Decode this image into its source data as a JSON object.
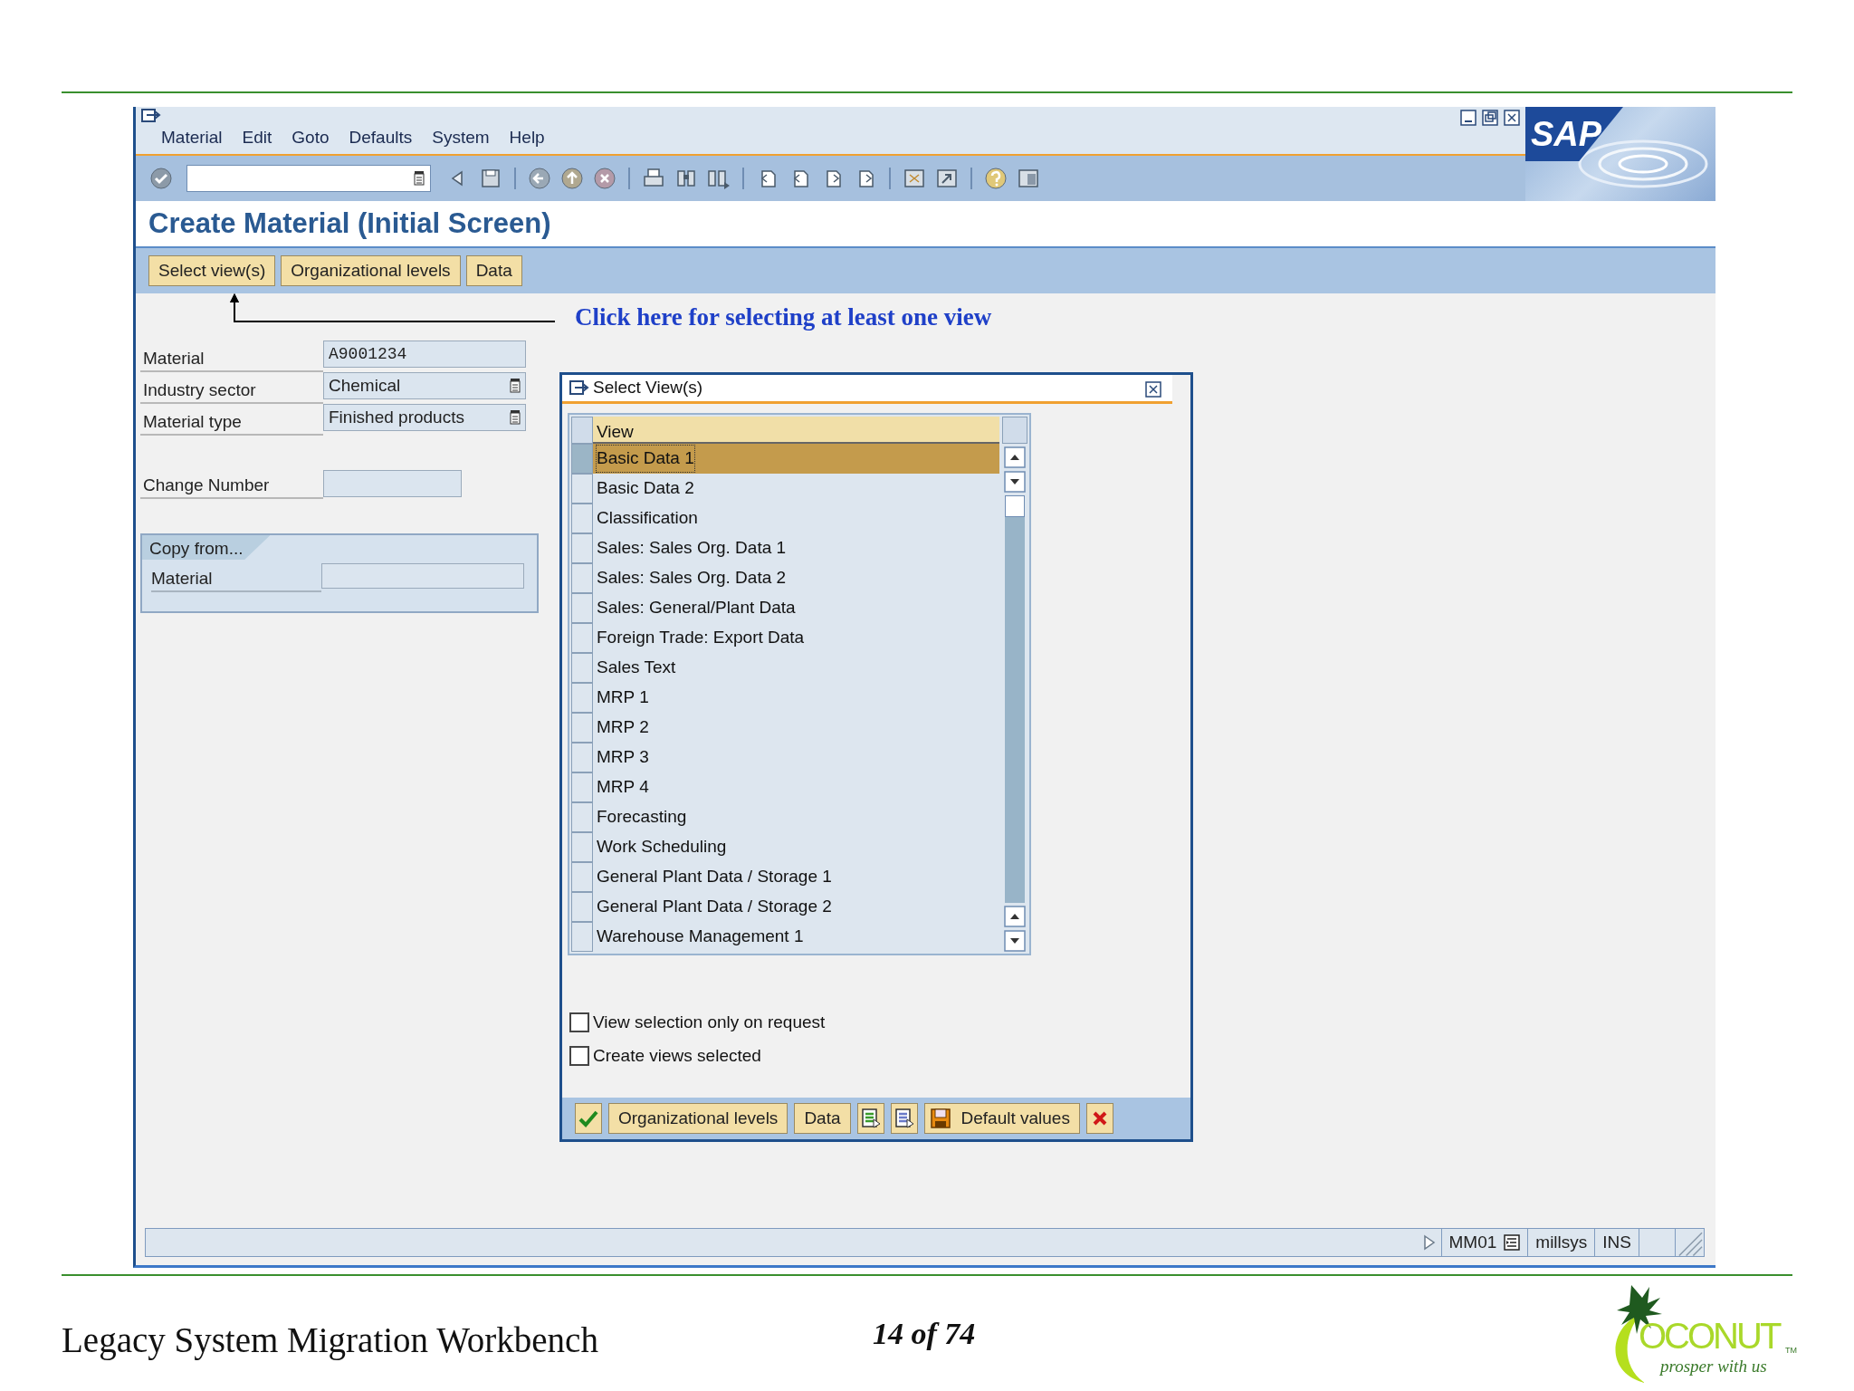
{
  "window": {
    "menu": [
      "Material",
      "Edit",
      "Goto",
      "Defaults",
      "System",
      "Help"
    ],
    "brand": "SAP",
    "title": "Create Material (Initial Screen)",
    "app_toolbar": [
      "Select view(s)",
      "Organizational levels",
      "Data"
    ]
  },
  "annotation": "Click here for selecting at least one view",
  "form": {
    "fields": [
      {
        "label": "Material",
        "value": "A9001234",
        "kind": "text"
      },
      {
        "label": "Industry sector",
        "value": "Chemical",
        "kind": "dropdown"
      },
      {
        "label": "Material type",
        "value": "Finished products",
        "kind": "dropdown"
      }
    ],
    "change_number": {
      "label": "Change Number"
    },
    "copy_from": {
      "title": "Copy from...",
      "fields": [
        {
          "label": "Material"
        }
      ]
    }
  },
  "dialog": {
    "title": "Select View(s)",
    "column": "View",
    "views": [
      {
        "label": "Basic Data 1",
        "selected": true
      },
      {
        "label": "Basic Data 2",
        "selected": false
      },
      {
        "label": "Classification",
        "selected": false
      },
      {
        "label": "Sales: Sales Org. Data 1",
        "selected": false
      },
      {
        "label": "Sales: Sales Org. Data 2",
        "selected": false
      },
      {
        "label": "Sales: General/Plant Data",
        "selected": false
      },
      {
        "label": "Foreign Trade: Export Data",
        "selected": false
      },
      {
        "label": "Sales Text",
        "selected": false
      },
      {
        "label": "MRP 1",
        "selected": false
      },
      {
        "label": "MRP 2",
        "selected": false
      },
      {
        "label": "MRP 3",
        "selected": false
      },
      {
        "label": "MRP 4",
        "selected": false
      },
      {
        "label": "Forecasting",
        "selected": false
      },
      {
        "label": "Work Scheduling",
        "selected": false
      },
      {
        "label": "General Plant Data / Storage 1",
        "selected": false
      },
      {
        "label": "General Plant Data / Storage 2",
        "selected": false
      },
      {
        "label": "Warehouse Management 1",
        "selected": false
      }
    ],
    "options": [
      {
        "label": "View selection only on request",
        "checked": false
      },
      {
        "label": "Create views selected",
        "checked": false
      }
    ],
    "buttons": [
      {
        "kind": "confirm"
      },
      {
        "kind": "text",
        "label": "Organizational levels"
      },
      {
        "kind": "text",
        "label": "Data"
      },
      {
        "kind": "green-list"
      },
      {
        "kind": "blue-list"
      },
      {
        "kind": "save",
        "label": "Default values"
      },
      {
        "kind": "cancel"
      }
    ]
  },
  "status_bar": {
    "transaction": "MM01",
    "system": "millsys",
    "mode": "INS"
  },
  "slide": {
    "footer_title": "Legacy System Migration Workbench",
    "page_number": "14 of 74",
    "logo": {
      "wordmark": "OCONUT",
      "trademark": "TM",
      "tagline": "prosper with us"
    }
  }
}
